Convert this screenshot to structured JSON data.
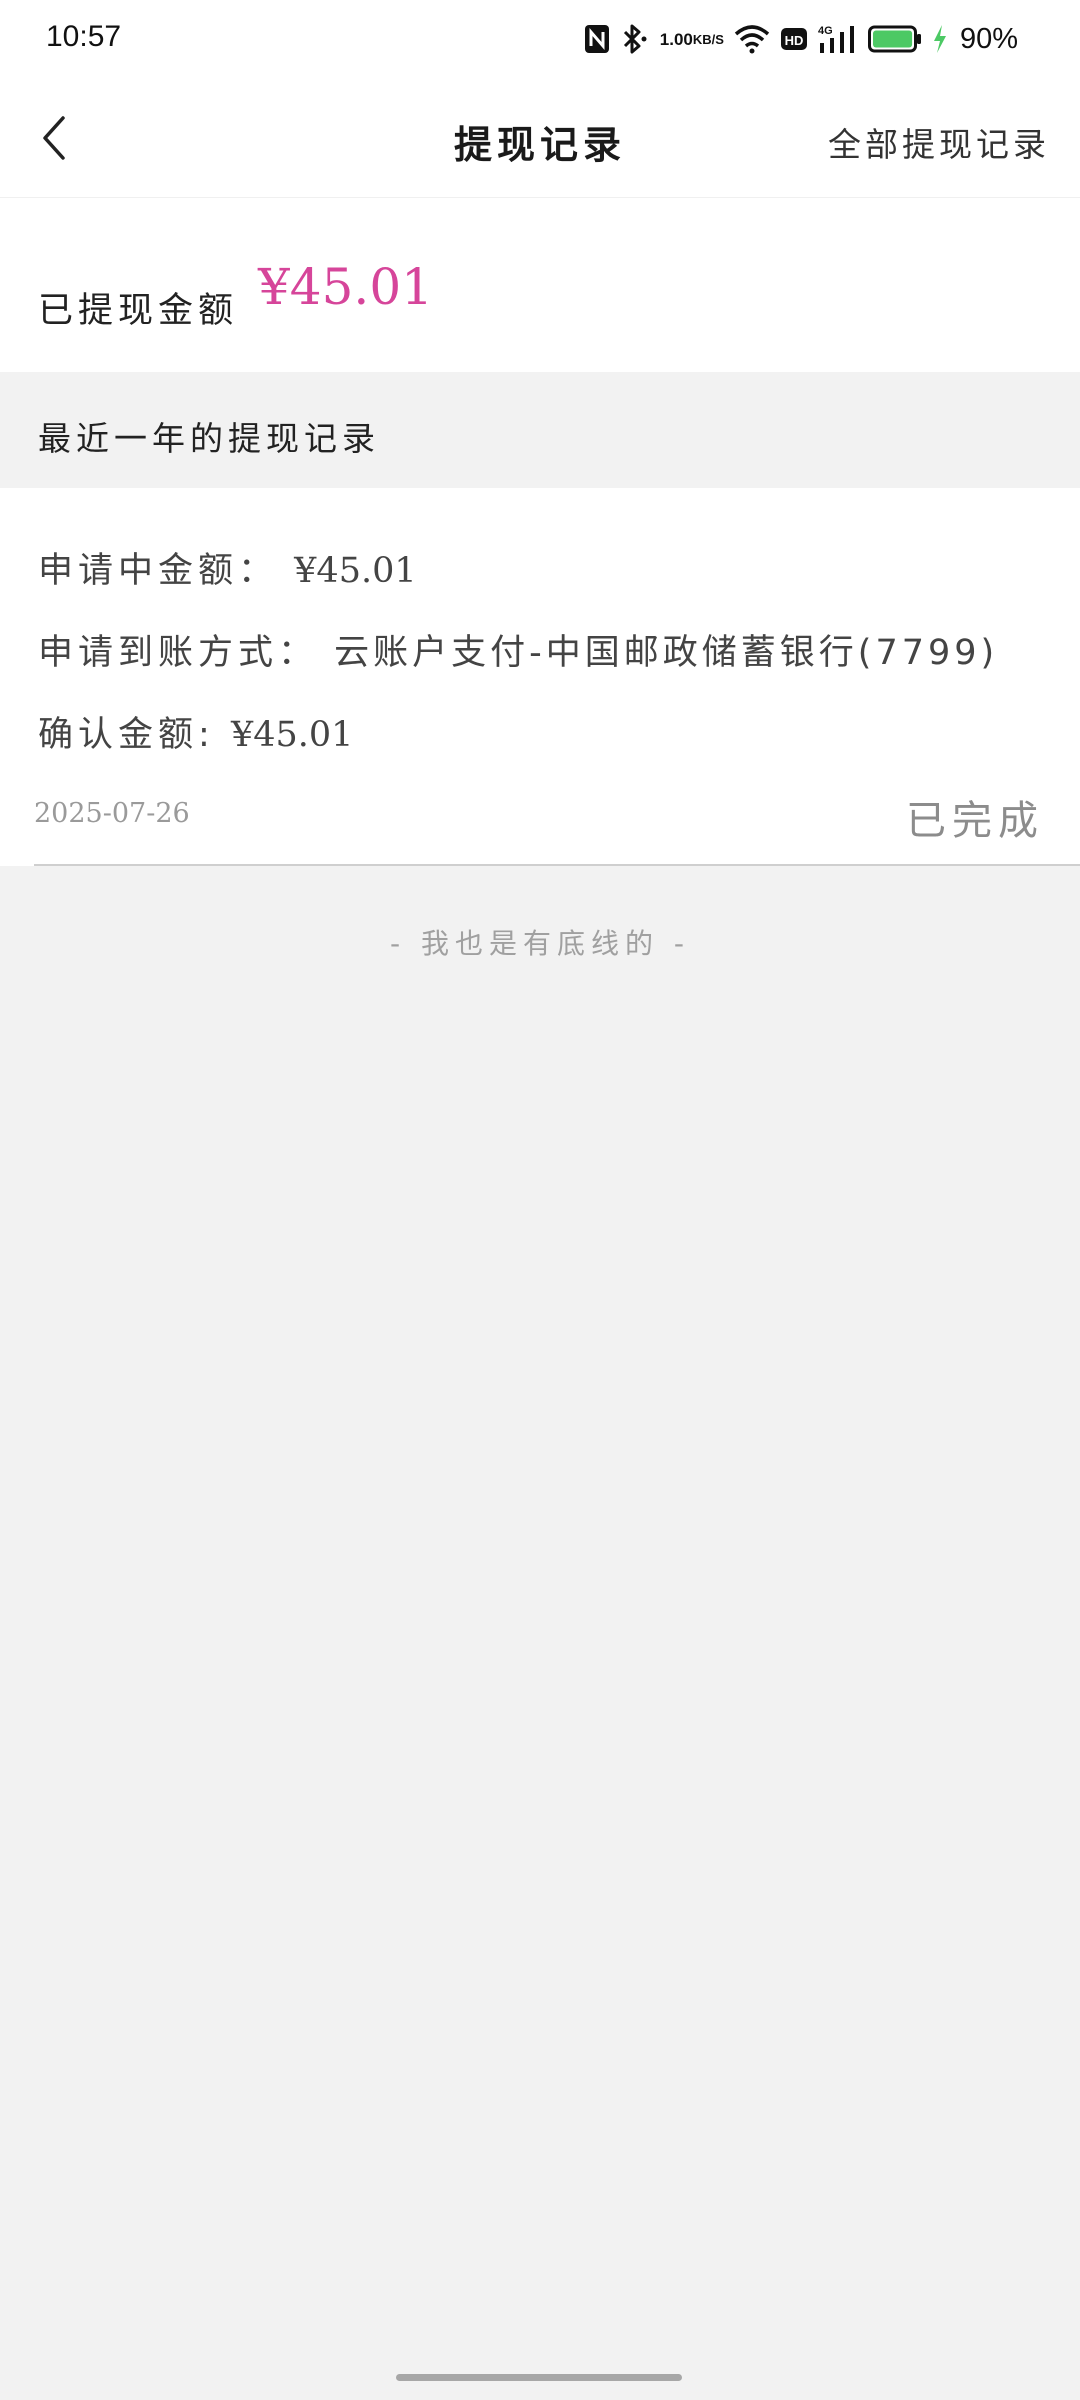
{
  "status_bar": {
    "time": "10:57",
    "net_speed_value": "1.00",
    "net_speed_unit": "KB/S",
    "network_type": "4G",
    "hd_label": "HD",
    "battery_percent": "90%",
    "battery_level": 0.9,
    "icons": [
      "nfc-icon",
      "bluetooth-icon",
      "wifi-icon",
      "hd-icon",
      "signal-icon",
      "battery-icon",
      "charging-icon"
    ]
  },
  "nav": {
    "title": "提现记录",
    "right_link": "全部提现记录",
    "back_icon": "chevron-left-icon"
  },
  "summary": {
    "label": "已提现金额",
    "amount": "¥45.01",
    "amount_color": "#d6459a"
  },
  "section": {
    "title": "最近一年的提现记录"
  },
  "records": [
    {
      "pending_label": "申请中金额：",
      "pending_amount": "¥45.01",
      "method_label": "申请到账方式：",
      "method_value": "云账户支付-中国邮政储蓄银行(7799)",
      "confirm_label": "确认金额:",
      "confirm_amount": "¥45.01",
      "date": "2025-07-26",
      "status": "已完成"
    }
  ],
  "footer": {
    "bottom_text": "- 我也是有底线的 -"
  }
}
